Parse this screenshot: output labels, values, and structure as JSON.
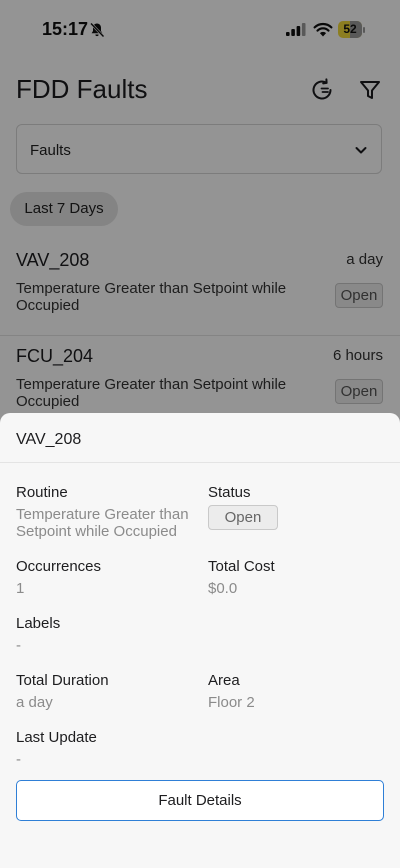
{
  "status_bar": {
    "time": "15:17",
    "battery_level": "52",
    "battery_fraction": 0.52,
    "battery_color": "#f2d93a"
  },
  "header": {
    "title": "FDD Faults"
  },
  "dropdown": {
    "selected": "Faults"
  },
  "filter_chip": {
    "label": "Last 7 Days"
  },
  "faults": [
    {
      "name": "VAV_208",
      "time": "a day",
      "description": "Temperature Greater than Setpoint while Occupied",
      "status": "Open"
    },
    {
      "name": "FCU_204",
      "time": "6 hours",
      "description": "Temperature Greater than Setpoint while Occupied",
      "status": "Open"
    }
  ],
  "sheet": {
    "title": "VAV_208",
    "routine_label": "Routine",
    "routine_value": "Temperature Greater than Setpoint while Occupied",
    "status_label": "Status",
    "status_value": "Open",
    "occurrences_label": "Occurrences",
    "occurrences_value": "1",
    "total_cost_label": "Total Cost",
    "total_cost_value": "$0.0",
    "labels_label": "Labels",
    "labels_value": "-",
    "total_duration_label": "Total Duration",
    "total_duration_value": "a day",
    "area_label": "Area",
    "area_value": "Floor 2",
    "last_update_label": "Last Update",
    "last_update_value": "-",
    "details_button": "Fault Details"
  },
  "colors": {
    "accent": "#2f7fd6"
  },
  "icons": [
    "bell-slash-icon",
    "cellular-signal-icon",
    "wifi-icon",
    "battery-icon",
    "history-icon",
    "filter-icon",
    "chevron-down-icon"
  ]
}
